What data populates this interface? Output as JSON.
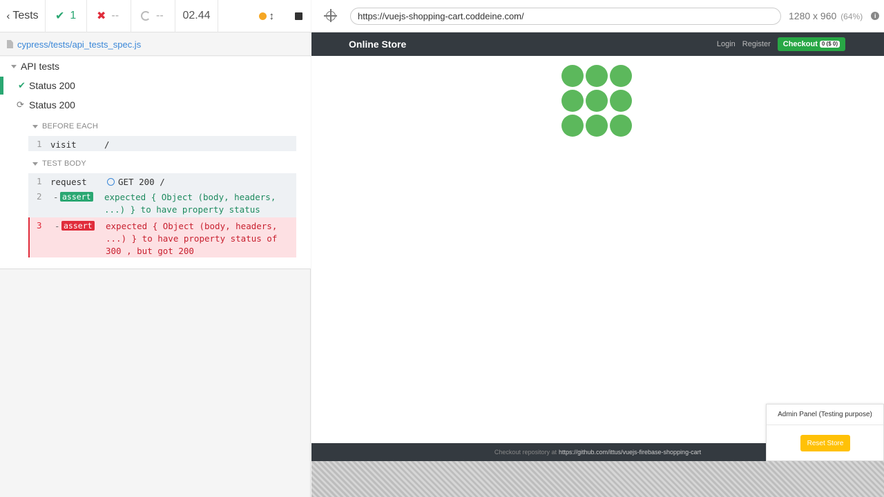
{
  "stats": {
    "tests_label": "Tests",
    "passed": "1",
    "failed": "--",
    "pending": "--",
    "duration": "02.44"
  },
  "spec": {
    "path": "cypress/tests/api_tests_spec.js"
  },
  "suite": {
    "title": "API tests",
    "tests": [
      {
        "title": "Status 200",
        "state": "passed"
      },
      {
        "title": "Status 200",
        "state": "running"
      }
    ]
  },
  "hooks": {
    "before_each": {
      "title": "BEFORE EACH",
      "commands": [
        {
          "n": "1",
          "name": "visit",
          "message": "/"
        }
      ]
    },
    "test_body": {
      "title": "TEST BODY",
      "commands": [
        {
          "n": "1",
          "name": "request",
          "message": "GET 200 /"
        },
        {
          "n": "2",
          "dash": "-",
          "name": "assert",
          "message_line1": "expected { Object (body, headers,",
          "message_line2": "...) } to have property  status"
        },
        {
          "n": "3",
          "dash": "-",
          "name": "assert",
          "message_line1": "expected { Object (body, headers,",
          "message_line2": "...) } to have property  status  of",
          "message_line3": "300 , but got  200"
        }
      ]
    }
  },
  "aut": {
    "url": "https://vuejs-shopping-cart.coddeine.com/",
    "viewport": "1280 x 960",
    "scale": "(64%)"
  },
  "app": {
    "brand": "Online Store",
    "nav": {
      "login": "Login",
      "register": "Register",
      "checkout": "Checkout",
      "checkout_badge": "0 ($ 0)"
    },
    "footer": {
      "text": "Checkout repository at",
      "link": "https://github.com/ittus/vuejs-firebase-shopping-cart"
    },
    "admin": {
      "title": "Admin Panel (Testing purpose)",
      "reset": "Reset Store"
    }
  },
  "colors": {
    "pass": "#2aa772",
    "fail": "#e02c3b",
    "link": "#3a87d8",
    "nav_bg": "#343a40",
    "spinner": "#5cb85c",
    "reset_btn": "#ffc107"
  }
}
